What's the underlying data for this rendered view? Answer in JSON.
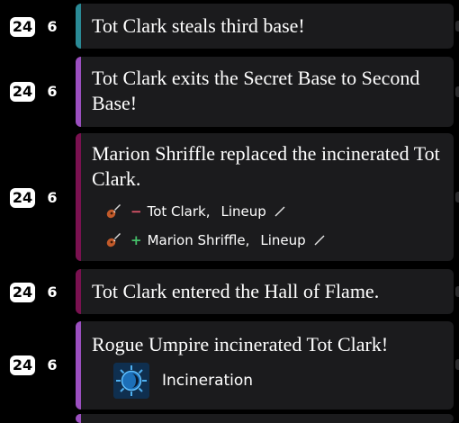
{
  "events": [
    {
      "season": "24",
      "day": "6",
      "text": "Tot Clark steals third base!",
      "bar_color": "#2a8a96"
    },
    {
      "season": "24",
      "day": "6",
      "text": "Tot Clark exits the Secret Base to Second Base!",
      "bar_color": "#9b4fc0"
    },
    {
      "season": "24",
      "day": "6",
      "text": "Marion Shriffle replaced the incinerated Tot Clark.",
      "bar_color": "#7a1150",
      "changes": [
        {
          "sign": "−",
          "player": "Tot Clark,",
          "location": "Lineup"
        },
        {
          "sign": "+",
          "player": "Marion Shriffle,",
          "location": "Lineup"
        }
      ]
    },
    {
      "season": "24",
      "day": "6",
      "text": "Tot Clark entered the Hall of Flame.",
      "bar_color": "#7a1150"
    },
    {
      "season": "24",
      "day": "6",
      "text": "Rogue Umpire incinerated Tot Clark!",
      "bar_color": "#9b4fc0",
      "modification": {
        "label": "Incineration",
        "icon": "incineration-icon"
      }
    }
  ],
  "icons": {
    "position_icon": "guitar-icon",
    "edit_icon": "pencil-icon"
  }
}
